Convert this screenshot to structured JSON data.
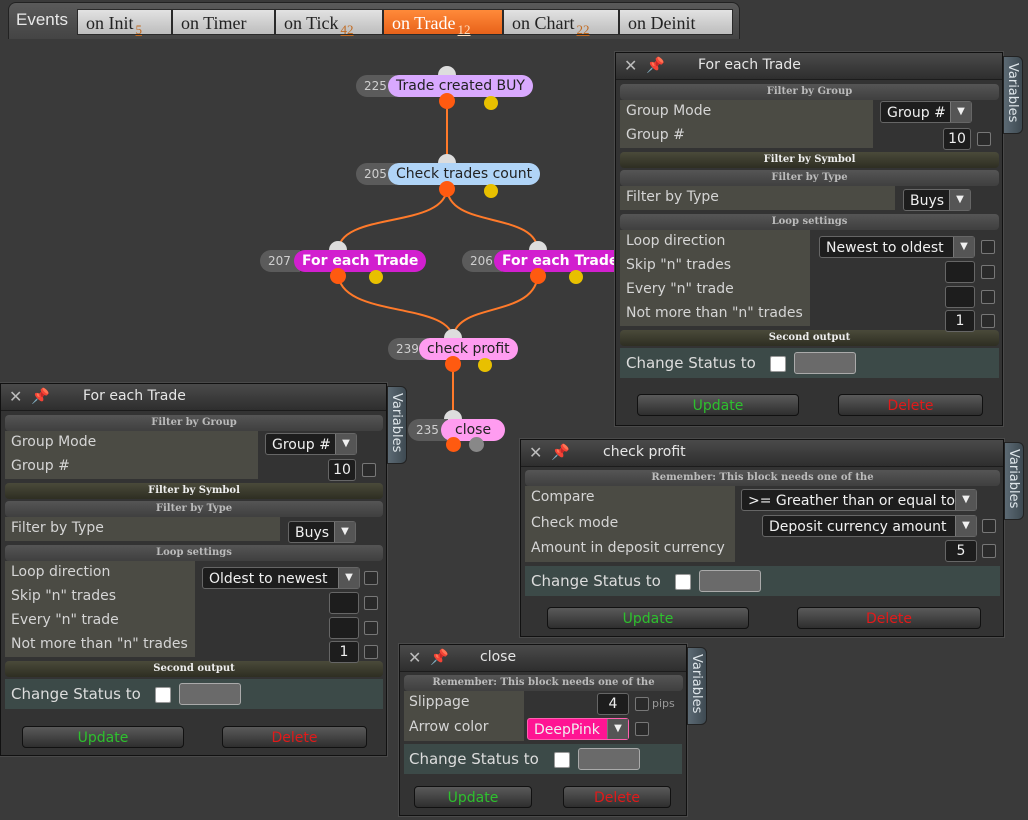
{
  "tabs": {
    "title": "Events",
    "items": [
      {
        "label": "on Init",
        "count": "5"
      },
      {
        "label": "on Timer",
        "count": ""
      },
      {
        "label": "on Tick",
        "count": "42"
      },
      {
        "label": "on Trade",
        "count": "12"
      },
      {
        "label": "on Chart",
        "count": "22"
      },
      {
        "label": "on Deinit",
        "count": ""
      }
    ],
    "active_index": 3
  },
  "nodes": [
    {
      "id": "225",
      "label": "Trade created BUY",
      "color": "#d9a9ff"
    },
    {
      "id": "205",
      "label": "Check trades count",
      "color": "#b0d4f7"
    },
    {
      "id": "207",
      "label": "For each Trade",
      "color": "#d21fcf"
    },
    {
      "id": "206",
      "label": "For each Trade",
      "color": "#d21fcf"
    },
    {
      "id": "239",
      "label": "check profit",
      "color": "#ff9cf0"
    },
    {
      "id": "235",
      "label": "close",
      "color": "#ff9cf0"
    }
  ],
  "panel_right_top": {
    "title": "For each Trade",
    "vertical_tab": "Variables",
    "sec_filter_group": "Filter by Group",
    "group_mode_label": "Group Mode",
    "group_mode_value": "Group #",
    "group_num_label": "Group #",
    "group_num_value": "10",
    "sec_filter_symbol": "Filter by Symbol",
    "sec_filter_type": "Filter by Type",
    "filter_type_label": "Filter by Type",
    "filter_type_value": "Buys",
    "sec_loop": "Loop settings",
    "loop_dir_label": "Loop direction",
    "loop_dir_value": "Newest to oldest",
    "skip_label": "Skip \"n\" trades",
    "every_label": "Every \"n\" trade",
    "notmore_label": "Not more than \"n\" trades",
    "notmore_value": "1",
    "sec_second": "Second output",
    "status_label": "Change Status to",
    "update": "Update",
    "delete": "Delete"
  },
  "panel_left": {
    "title": "For each Trade",
    "vertical_tab": "Variables",
    "sec_filter_group": "Filter by Group",
    "group_mode_label": "Group Mode",
    "group_mode_value": "Group #",
    "group_num_label": "Group #",
    "group_num_value": "10",
    "sec_filter_symbol": "Filter by Symbol",
    "sec_filter_type": "Filter by Type",
    "filter_type_label": "Filter by Type",
    "filter_type_value": "Buys",
    "sec_loop": "Loop settings",
    "loop_dir_label": "Loop direction",
    "loop_dir_value": "Oldest to newest",
    "skip_label": "Skip \"n\" trades",
    "every_label": "Every \"n\" trade",
    "notmore_label": "Not more than \"n\" trades",
    "notmore_value": "1",
    "sec_second": "Second output",
    "status_label": "Change Status to",
    "update": "Update",
    "delete": "Delete"
  },
  "panel_check": {
    "title": "check profit",
    "vertical_tab": "Variables",
    "sec_remember": "Remember: This block needs one of the",
    "compare_label": "Compare",
    "compare_value": ">= Greather than or equal to",
    "mode_label": "Check mode",
    "mode_value": "Deposit currency amount",
    "amount_label": "Amount in deposit currency",
    "amount_value": "5",
    "status_label": "Change Status to",
    "update": "Update",
    "delete": "Delete"
  },
  "panel_close": {
    "title": "close",
    "vertical_tab": "Variables",
    "sec_remember": "Remember: This block needs one of the",
    "slippage_label": "Slippage",
    "slippage_value": "4",
    "slippage_unit": "pips",
    "arrow_label": "Arrow color",
    "arrow_value": "DeepPink",
    "arrow_color": "#ff1493",
    "status_label": "Change Status to",
    "update": "Update",
    "delete": "Delete"
  }
}
